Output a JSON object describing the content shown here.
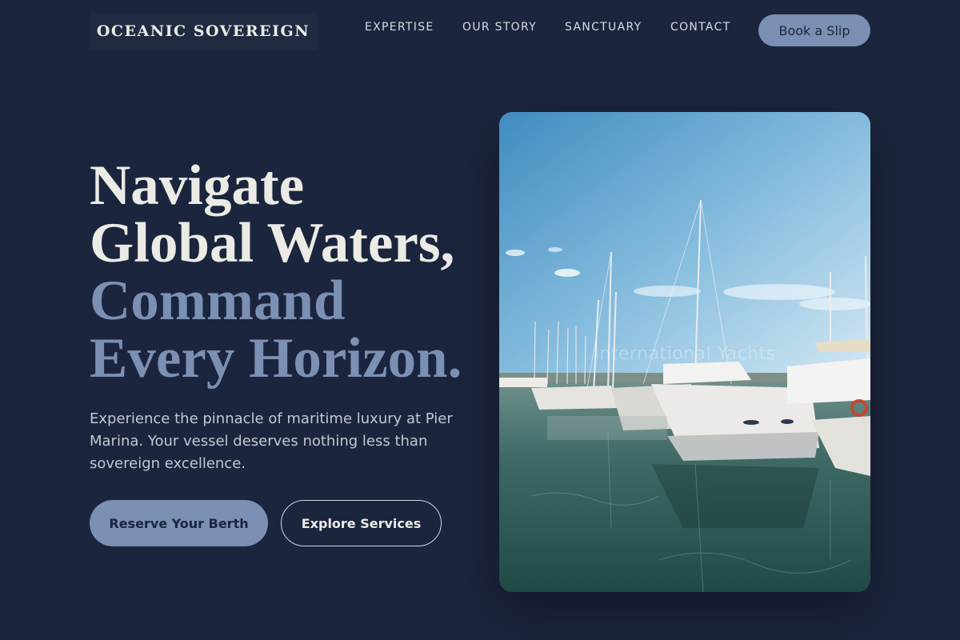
{
  "brand": {
    "name": "OCEANIC SOVEREIGN"
  },
  "nav": {
    "links": [
      {
        "label": "EXPERTISE"
      },
      {
        "label": "OUR STORY"
      },
      {
        "label": "SANCTUARY"
      },
      {
        "label": "CONTACT"
      }
    ],
    "cta_label": "Book a Slip"
  },
  "hero": {
    "headline_line1": "Navigate",
    "headline_line2": "Global Waters,",
    "headline_line3": "Command",
    "headline_line4": "Every Horizon.",
    "description": "Experience the pinnacle of maritime luxury at Pier Marina. Your vessel deserves nothing less than sovereign excellence.",
    "primary_button": "Reserve Your Berth",
    "secondary_button": "Explore Services",
    "image": {
      "alt": "Yachts moored in a marina",
      "watermark": "International Yachts"
    }
  },
  "colors": {
    "background": "#1b253d",
    "accent": "#7b90b3",
    "text_light": "#eceae4"
  }
}
